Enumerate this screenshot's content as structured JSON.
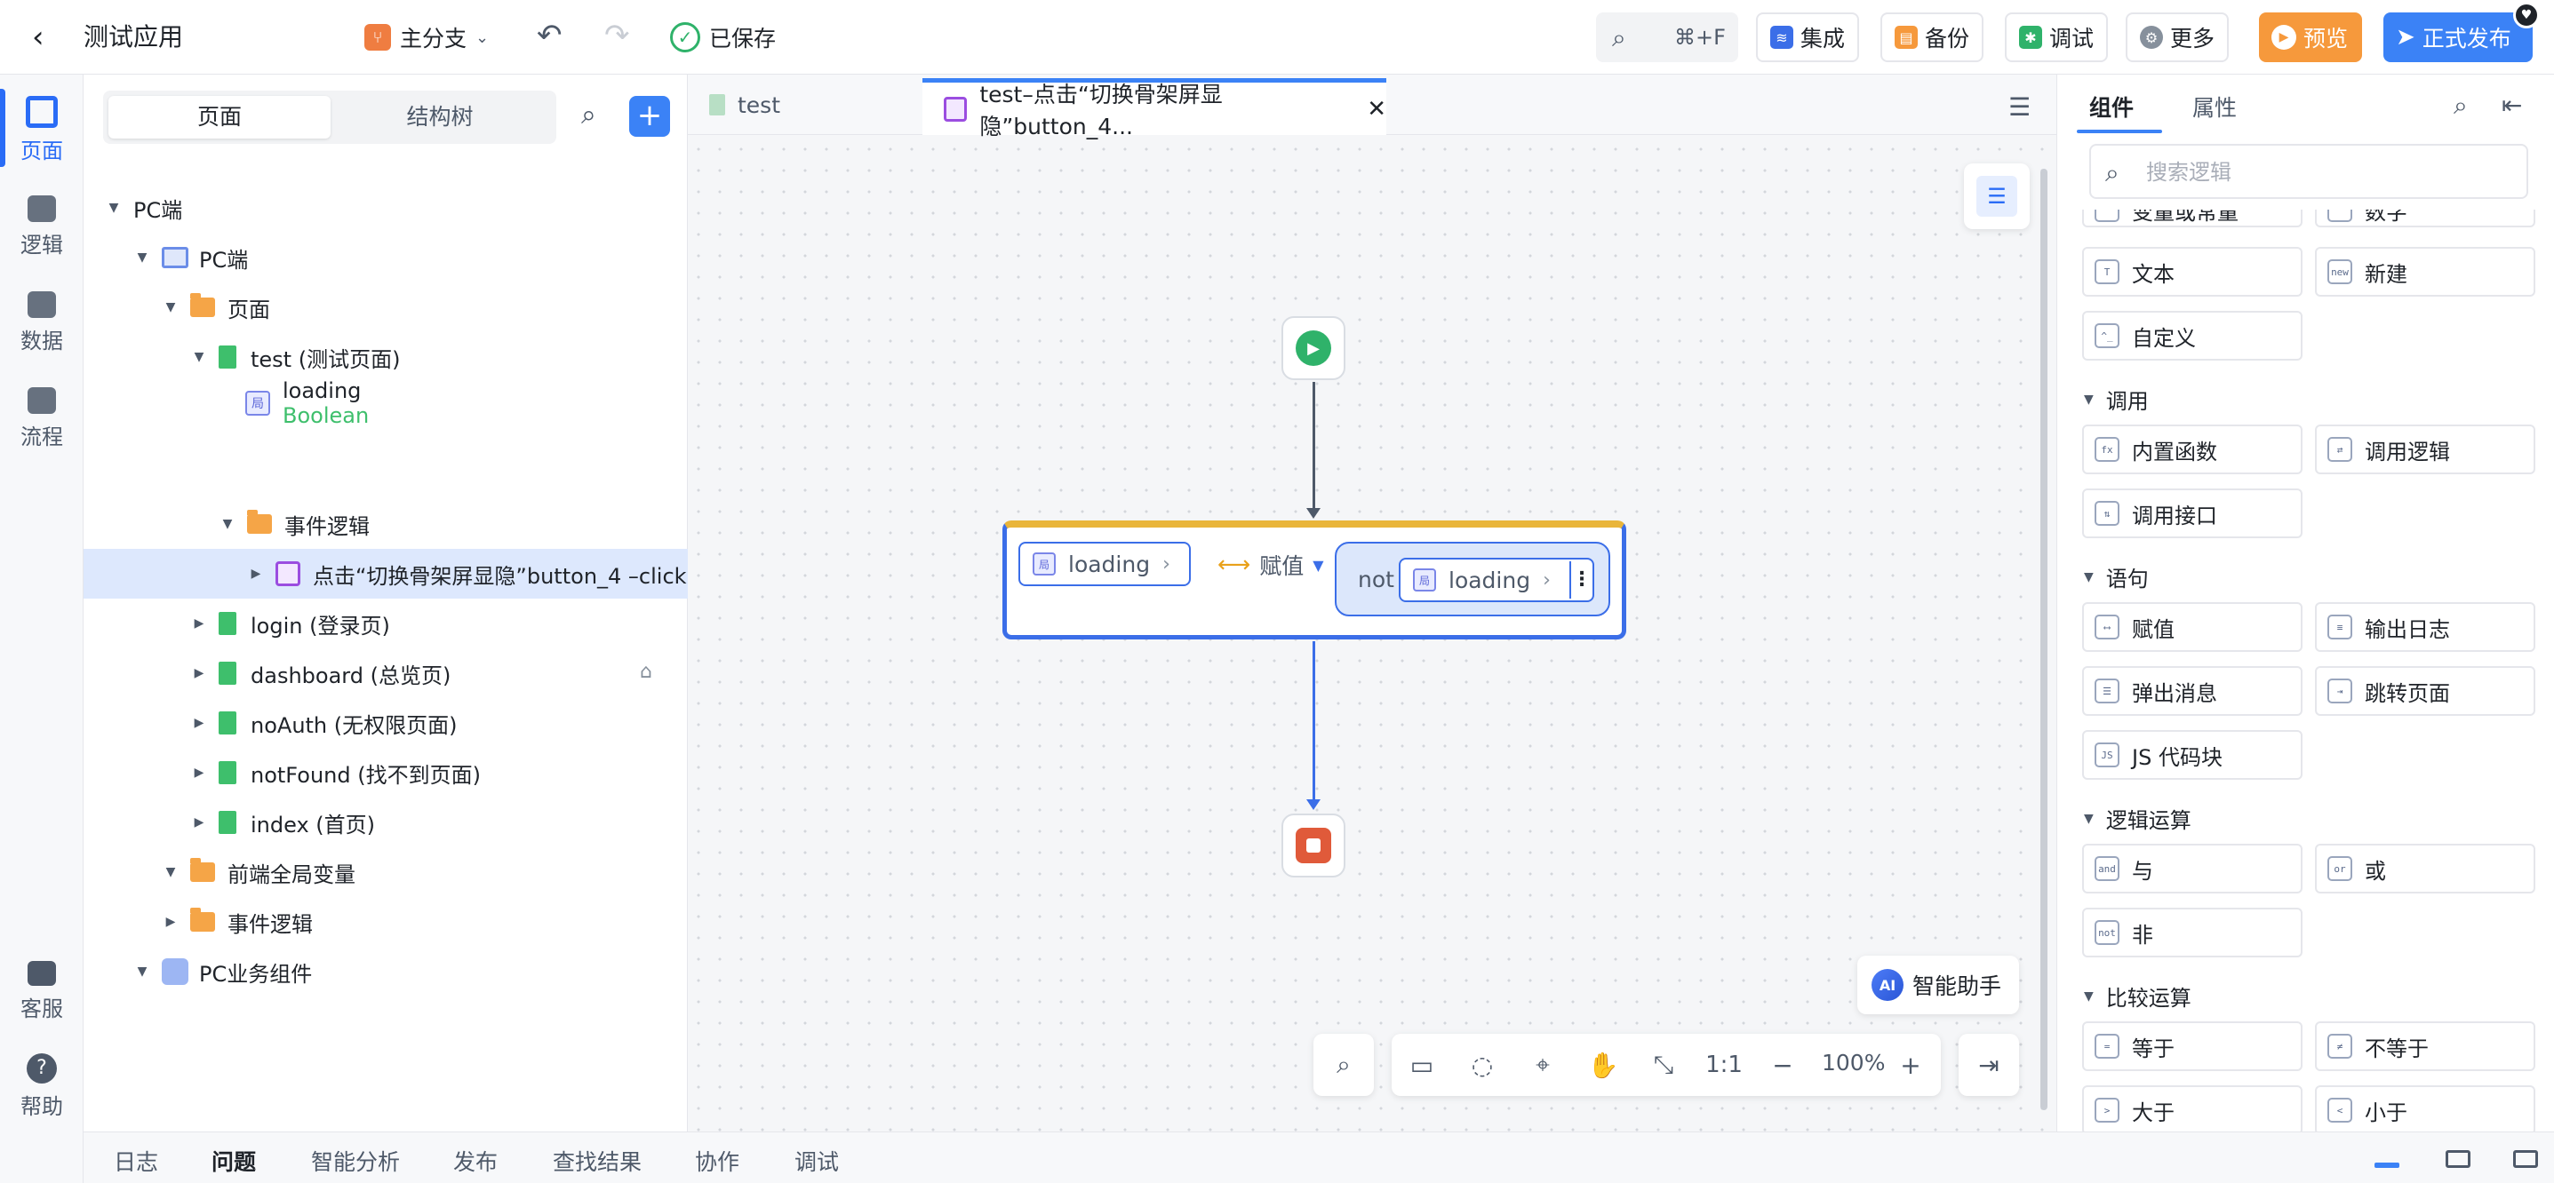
{
  "header": {
    "title": "测试应用",
    "branch": "主分支",
    "saved": "已保存",
    "search_shortcut": "⌘+F",
    "buttons": {
      "integrate": "集成",
      "backup": "备份",
      "debug": "调试",
      "more": "更多",
      "preview": "预览",
      "publish": "正式发布"
    }
  },
  "rail": {
    "items": [
      "页面",
      "逻辑",
      "数据",
      "流程"
    ],
    "bottom": [
      "客服",
      "帮助"
    ]
  },
  "tree": {
    "tabs": [
      "页面",
      "结构树"
    ],
    "nodes": [
      "PC端",
      "PC端",
      "页面",
      "test (测试页面)",
      "loading",
      "Boolean",
      "事件逻辑",
      "点击“切换骨架屏显隐”button_4 –click",
      "login (登录页)",
      "dashboard (总览页)",
      "noAuth (无权限页面)",
      "notFound (找不到页面)",
      "index (首页)",
      "前端全局变量",
      "事件逻辑",
      "PC业务组件"
    ]
  },
  "editor": {
    "tabs": [
      "test",
      "test–点击“切换骨架屏显隐”button_4..."
    ],
    "assign": {
      "left_var": "loading",
      "op": "赋值",
      "not": "not",
      "right_var": "loading"
    },
    "ai_assistant": "智能助手",
    "zoom_ratio": "1:1",
    "zoom": "100%"
  },
  "components": {
    "tabs": [
      "组件",
      "属性"
    ],
    "search_placeholder": "搜索逻辑",
    "partial_top": [
      "变量或常量",
      "数字"
    ],
    "top_items": [
      "文本",
      "新建",
      "自定义"
    ],
    "icon_labels": {
      "text": "T",
      "new": "new",
      "custom": "^_",
      "fx": "fx",
      "and": "and",
      "or": "or",
      "not": "not",
      "js": "JS",
      "eq": "=",
      "ne": "≠",
      "gt": ">",
      "lt": "<"
    },
    "sections": [
      {
        "title": "调用",
        "items": [
          "内置函数",
          "调用逻辑",
          "调用接口"
        ]
      },
      {
        "title": "语句",
        "items": [
          "赋值",
          "输出日志",
          "弹出消息",
          "跳转页面",
          "JS 代码块"
        ]
      },
      {
        "title": "逻辑运算",
        "items": [
          "与",
          "或",
          "非"
        ]
      },
      {
        "title": "比较运算",
        "items": [
          "等于",
          "不等于",
          "大于",
          "小于"
        ]
      }
    ]
  },
  "bottom_tabs": [
    "日志",
    "问题",
    "智能分析",
    "发布",
    "查找结果",
    "协作",
    "调试"
  ]
}
